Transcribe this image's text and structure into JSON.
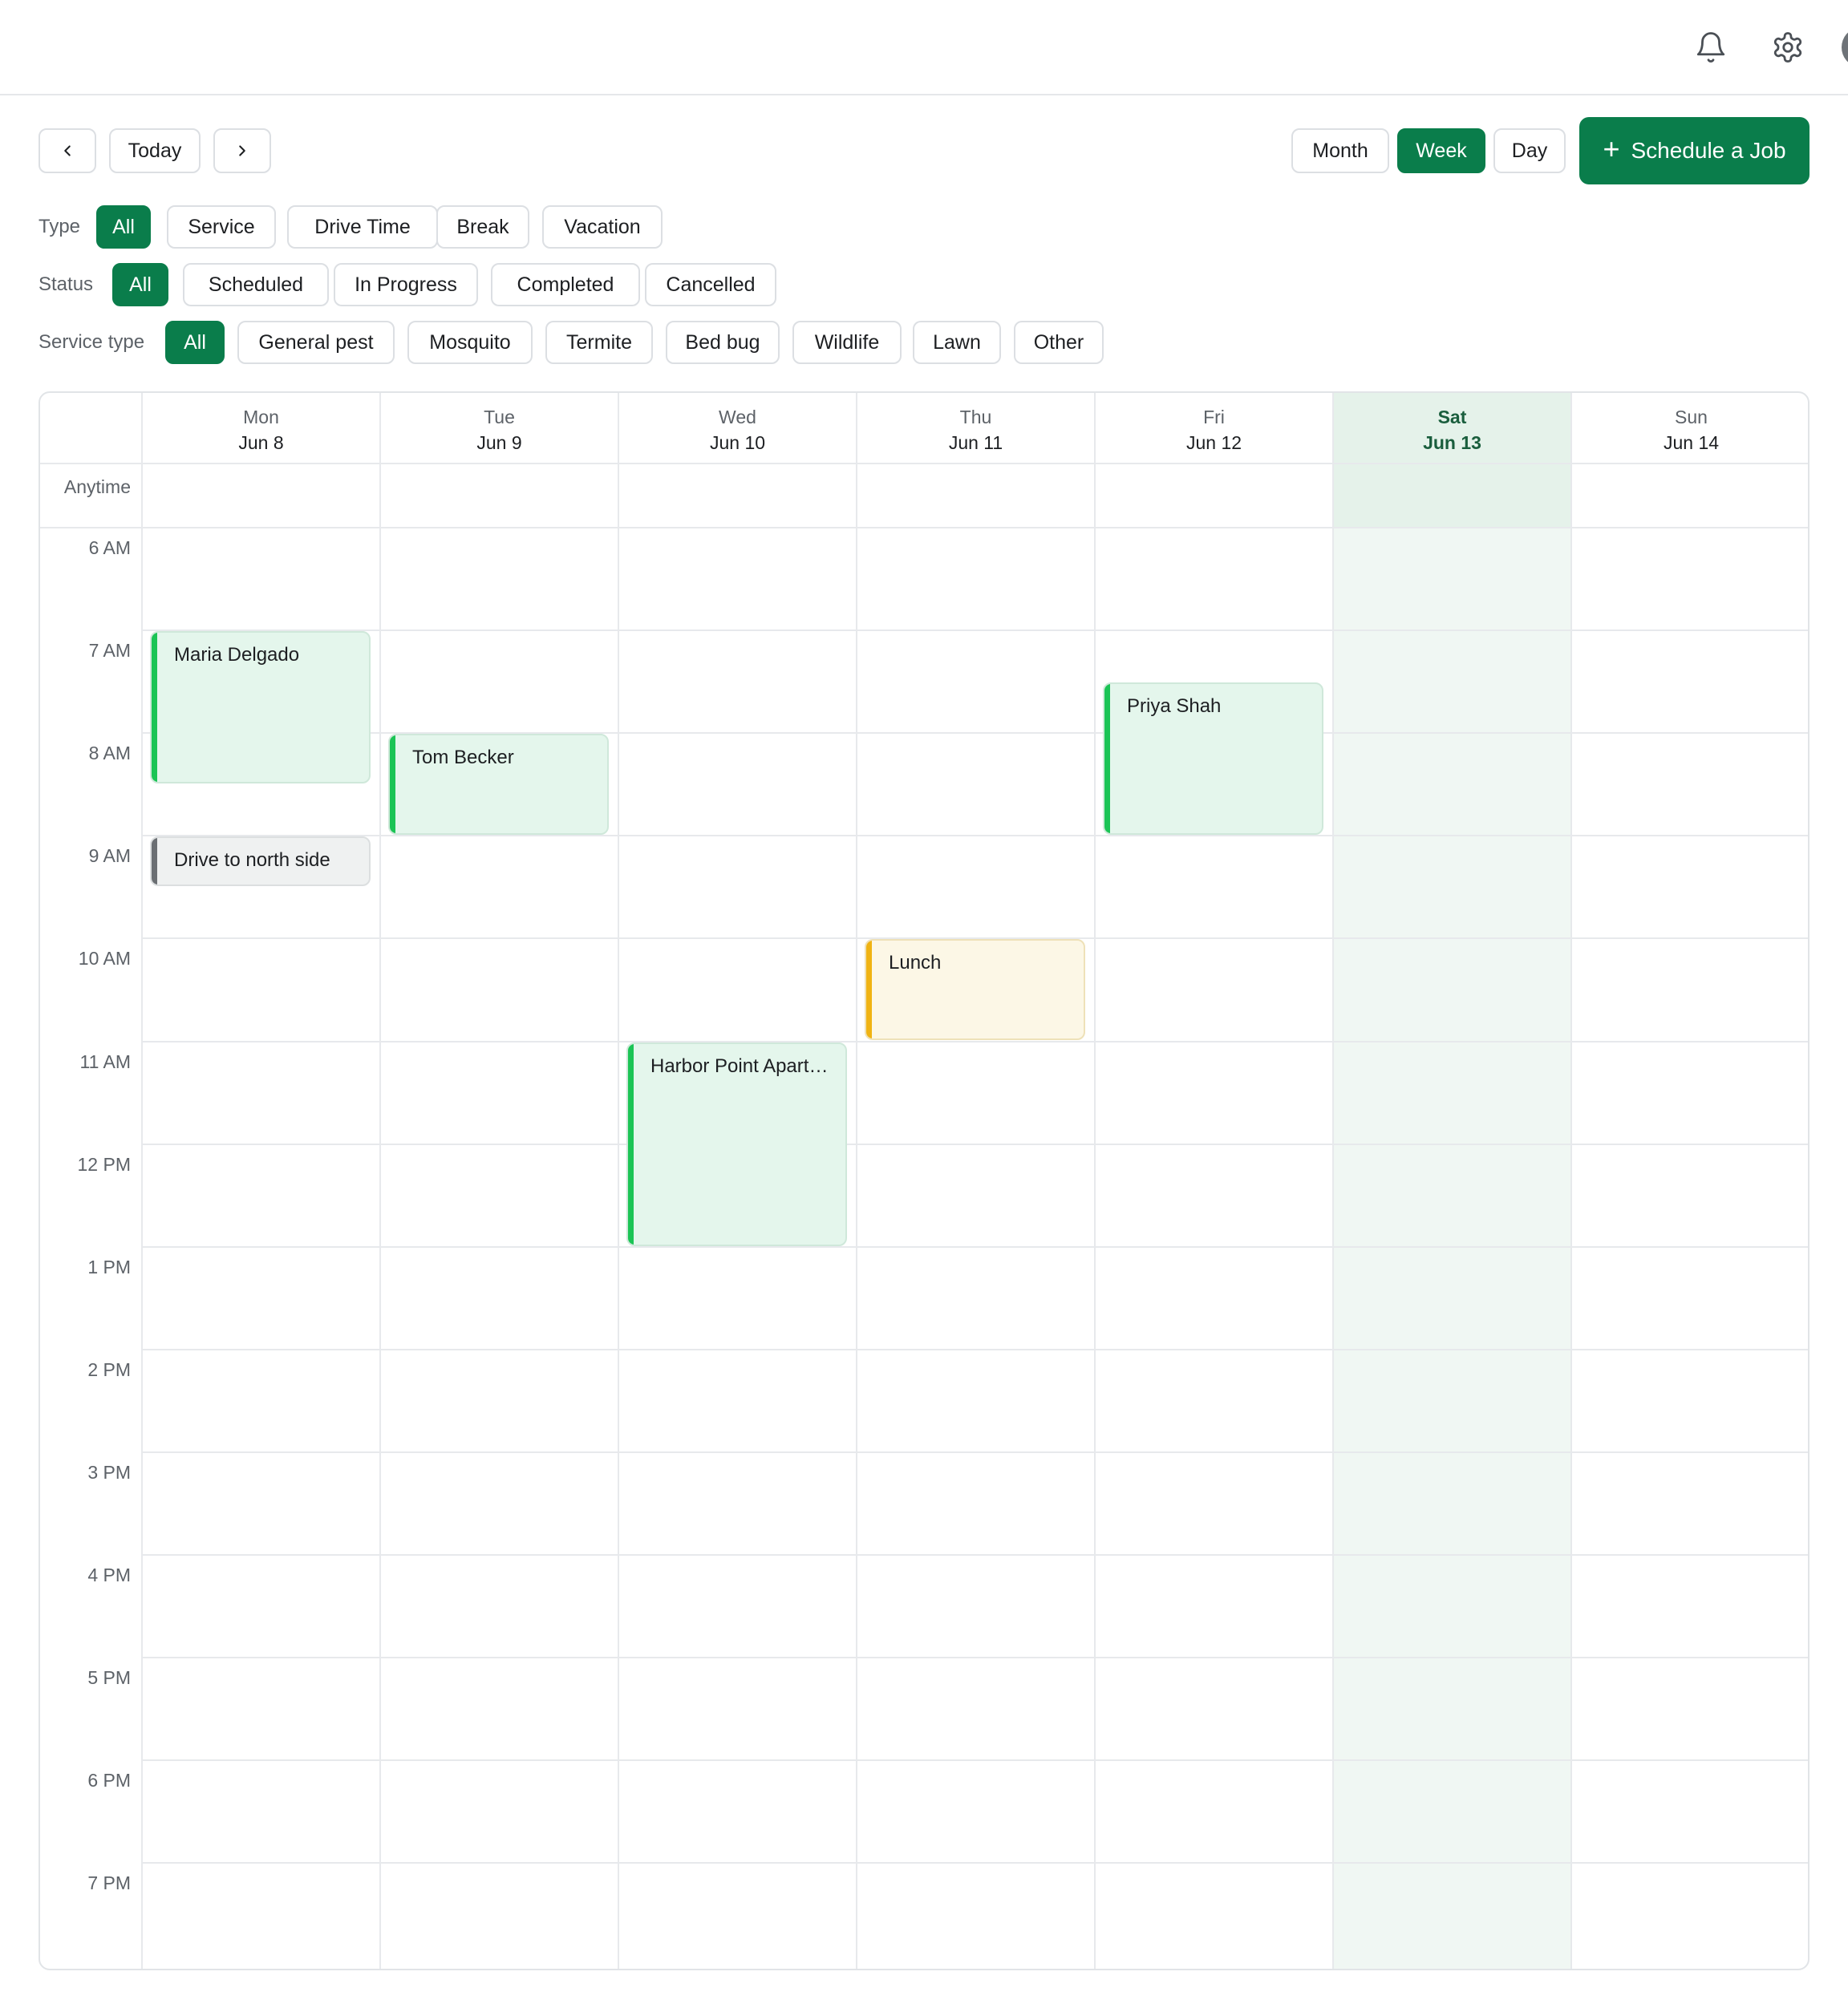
{
  "toolbar": {
    "prev_icon": "chevron-left-icon",
    "today_label": "Today",
    "next_icon": "chevron-right-icon",
    "views": [
      {
        "label": "Month",
        "active": false
      },
      {
        "label": "Week",
        "active": true
      },
      {
        "label": "Day",
        "active": false
      }
    ],
    "cta_label": "Schedule a Job",
    "cta_icon": "plus-icon"
  },
  "header_icons": [
    "bell-icon",
    "gear-icon",
    "avatar"
  ],
  "filters": {
    "type": {
      "label": "Type",
      "options": [
        "All",
        "Service",
        "Drive Time",
        "Break",
        "Vacation"
      ],
      "active": "All"
    },
    "status": {
      "label": "Status",
      "options": [
        "All",
        "Scheduled",
        "In Progress",
        "Completed",
        "Cancelled"
      ],
      "active": "All"
    },
    "service_type": {
      "label": "Service type",
      "options": [
        "All",
        "General pest",
        "Mosquito",
        "Termite",
        "Bed bug",
        "Wildlife",
        "Lawn",
        "Other"
      ],
      "active": "All"
    }
  },
  "calendar": {
    "anytime_label": "Anytime",
    "days": [
      {
        "name": "Mon",
        "date": "Jun 8",
        "today": false
      },
      {
        "name": "Tue",
        "date": "Jun 9",
        "today": false
      },
      {
        "name": "Wed",
        "date": "Jun 10",
        "today": false
      },
      {
        "name": "Thu",
        "date": "Jun 11",
        "today": false
      },
      {
        "name": "Fri",
        "date": "Jun 12",
        "today": false
      },
      {
        "name": "Sat",
        "date": "Jun 13",
        "today": true
      },
      {
        "name": "Sun",
        "date": "Jun 14",
        "today": false
      }
    ],
    "hours": [
      "6 AM",
      "7 AM",
      "8 AM",
      "9 AM",
      "10 AM",
      "11 AM",
      "12 PM",
      "1 PM",
      "2 PM",
      "3 PM",
      "4 PM",
      "5 PM",
      "6 PM",
      "7 PM"
    ],
    "events": [
      {
        "title": "Maria Delgado",
        "day": 0,
        "start": 7,
        "end": 8.5,
        "kind": "service",
        "color": "#1bc455"
      },
      {
        "title": "Drive to north side",
        "day": 0,
        "start": 9,
        "end": 9.5,
        "kind": "drive",
        "color": "#6b6f73"
      },
      {
        "title": "Tom Becker",
        "day": 1,
        "start": 8,
        "end": 9,
        "kind": "service",
        "color": "#1bc455"
      },
      {
        "title": "Harbor Point Apart…",
        "day": 2,
        "start": 11,
        "end": 13,
        "kind": "service",
        "color": "#1bc455"
      },
      {
        "title": "Lunch",
        "day": 3,
        "start": 10,
        "end": 11,
        "kind": "break",
        "color": "#f0b313"
      },
      {
        "title": "Priya Shah",
        "day": 4,
        "start": 7.5,
        "end": 9,
        "kind": "service",
        "color": "#1bc455"
      }
    ]
  },
  "colors": {
    "accent": "#0a7d4b",
    "today_column": "#f0f7f3"
  }
}
